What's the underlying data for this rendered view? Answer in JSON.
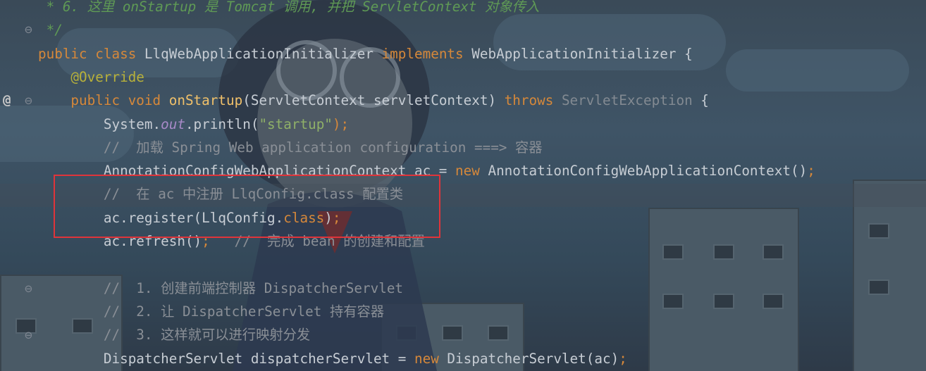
{
  "editor": {
    "lines": [
      {
        "id": "l1",
        "parts": [
          {
            "t": " * 6. 这里 onStartup 是 Tomcat 调用, 并把 ServletContext 对象传入",
            "c": "doc"
          }
        ]
      },
      {
        "id": "l2",
        "parts": [
          {
            "t": " */",
            "c": "doc"
          }
        ]
      },
      {
        "id": "l3",
        "parts": [
          {
            "t": "public class ",
            "c": "kw"
          },
          {
            "t": "LlqWebApplicationInitializer ",
            "c": "tx"
          },
          {
            "t": "implements ",
            "c": "kw"
          },
          {
            "t": "WebApplicationInitializer {",
            "c": "tx"
          }
        ]
      },
      {
        "id": "l4",
        "parts": [
          {
            "t": "    @Override",
            "c": "ann"
          }
        ]
      },
      {
        "id": "l5",
        "parts": [
          {
            "t": "    public void ",
            "c": "kw"
          },
          {
            "t": "onStartup",
            "c": "fn"
          },
          {
            "t": "(ServletContext servletContext) ",
            "c": "tx"
          },
          {
            "t": "throws ",
            "c": "kw"
          },
          {
            "t": "ServletException",
            "c": "grey"
          },
          {
            "t": " {",
            "c": "tx"
          }
        ]
      },
      {
        "id": "l6",
        "parts": [
          {
            "t": "        System.",
            "c": "tx"
          },
          {
            "t": "out",
            "c": "fld"
          },
          {
            "t": ".println(",
            "c": "tx"
          },
          {
            "t": "\"startup\"",
            "c": "str"
          },
          {
            "t": ");",
            "c": "kw"
          }
        ]
      },
      {
        "id": "l7",
        "parts": [
          {
            "t": "        //  加载 Spring Web application configuration ===> 容器",
            "c": "cm"
          }
        ]
      },
      {
        "id": "l8",
        "parts": [
          {
            "t": "        AnnotationConfigWebApplicationContext ac = ",
            "c": "tx"
          },
          {
            "t": "new ",
            "c": "kw"
          },
          {
            "t": "AnnotationConfigWebApplicationContext()",
            "c": "tx"
          },
          {
            "t": ";",
            "c": "kw"
          }
        ]
      },
      {
        "id": "l9",
        "parts": [
          {
            "t": "        //  在 ac 中注册 LlqConfig.class 配置类",
            "c": "cm"
          }
        ]
      },
      {
        "id": "l10",
        "parts": [
          {
            "t": "        ac.register(LlqConfig.",
            "c": "tx"
          },
          {
            "t": "class",
            "c": "kw"
          },
          {
            "t": ")",
            "c": "tx"
          },
          {
            "t": ";",
            "c": "kw"
          }
        ]
      },
      {
        "id": "l11",
        "parts": [
          {
            "t": "        ac.refresh()",
            "c": "tx"
          },
          {
            "t": ";",
            "c": "kw"
          },
          {
            "t": "   //  完成 bean 的创建和配置",
            "c": "cm"
          }
        ]
      },
      {
        "id": "l12",
        "parts": []
      },
      {
        "id": "l13",
        "parts": [
          {
            "t": "        //  1. 创建前端控制器 DispatcherServlet",
            "c": "cm"
          }
        ]
      },
      {
        "id": "l14",
        "parts": [
          {
            "t": "        //  2. 让 DispatcherServlet 持有容器",
            "c": "cm"
          }
        ]
      },
      {
        "id": "l15",
        "parts": [
          {
            "t": "        //  3. 这样就可以进行映射分发",
            "c": "cm"
          }
        ]
      },
      {
        "id": "l16",
        "parts": [
          {
            "t": "        DispatcherServlet dispatcherServlet = ",
            "c": "tx"
          },
          {
            "t": "new ",
            "c": "kw"
          },
          {
            "t": "DispatcherServlet(ac)",
            "c": "tx"
          },
          {
            "t": ";",
            "c": "kw"
          }
        ]
      }
    ]
  },
  "gutter": {
    "override_marker": "@",
    "fold_icon": "fold-marker-icon"
  },
  "colors": {
    "keyword": "#d6883a",
    "annotation": "#b8b13a",
    "method": "#f0c06a",
    "string": "#8fb068",
    "comment": "#8a8f96",
    "doc_comment": "#5f9a55",
    "highlight_box": "#e0343a"
  }
}
